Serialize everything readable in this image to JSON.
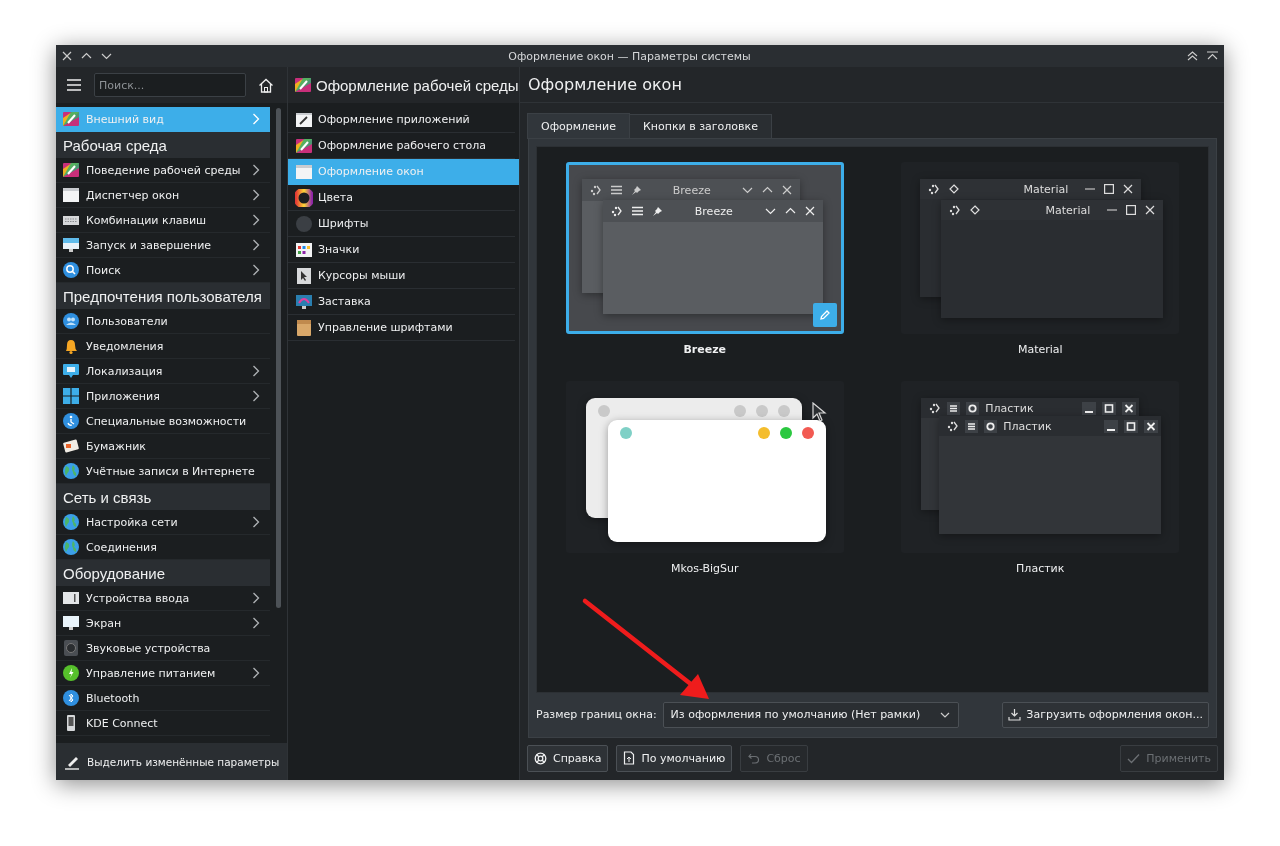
{
  "window": {
    "title": "Оформление окон — Параметры системы"
  },
  "sidebar": {
    "search": {
      "placeholder": "Поиск..."
    },
    "items": [
      {
        "kind": "item",
        "label": "Внешний вид",
        "selected": true,
        "expandable": true
      },
      {
        "kind": "header",
        "label": "Рабочая среда"
      },
      {
        "kind": "item",
        "label": "Поведение рабочей среды",
        "selected": false,
        "expandable": true
      },
      {
        "kind": "item",
        "label": "Диспетчер окон",
        "selected": false,
        "expandable": true
      },
      {
        "kind": "item",
        "label": "Комбинации клавиш",
        "selected": false,
        "expandable": true
      },
      {
        "kind": "item",
        "label": "Запуск и завершение",
        "selected": false,
        "expandable": true
      },
      {
        "kind": "item",
        "label": "Поиск",
        "selected": false,
        "expandable": true
      },
      {
        "kind": "header",
        "label": "Предпочтения пользователя"
      },
      {
        "kind": "item",
        "label": "Пользователи",
        "selected": false,
        "expandable": false
      },
      {
        "kind": "item",
        "label": "Уведомления",
        "selected": false,
        "expandable": false
      },
      {
        "kind": "item",
        "label": "Локализация",
        "selected": false,
        "expandable": true
      },
      {
        "kind": "item",
        "label": "Приложения",
        "selected": false,
        "expandable": true
      },
      {
        "kind": "item",
        "label": "Специальные возможности",
        "selected": false,
        "expandable": false
      },
      {
        "kind": "item",
        "label": "Бумажник",
        "selected": false,
        "expandable": false
      },
      {
        "kind": "item",
        "label": "Учётные записи в Интернете",
        "selected": false,
        "expandable": false
      },
      {
        "kind": "header",
        "label": "Сеть и связь"
      },
      {
        "kind": "item",
        "label": "Настройка сети",
        "selected": false,
        "expandable": true
      },
      {
        "kind": "item",
        "label": "Соединения",
        "selected": false,
        "expandable": false
      },
      {
        "kind": "header",
        "label": "Оборудование"
      },
      {
        "kind": "item",
        "label": "Устройства ввода",
        "selected": false,
        "expandable": true
      },
      {
        "kind": "item",
        "label": "Экран",
        "selected": false,
        "expandable": true
      },
      {
        "kind": "item",
        "label": "Звуковые устройства",
        "selected": false,
        "expandable": false
      },
      {
        "kind": "item",
        "label": "Управление питанием",
        "selected": false,
        "expandable": true
      },
      {
        "kind": "item",
        "label": "Bluetooth",
        "selected": false,
        "expandable": false
      },
      {
        "kind": "item",
        "label": "KDE Connect",
        "selected": false,
        "expandable": false
      }
    ],
    "highlight_button": "Выделить изменённые параметры"
  },
  "subpanel": {
    "title": "Оформление рабочей среды",
    "items": [
      {
        "label": "Оформление приложений",
        "selected": false
      },
      {
        "label": "Оформление рабочего стола",
        "selected": false
      },
      {
        "label": "Оформление окон",
        "selected": true
      },
      {
        "label": "Цвета",
        "selected": false
      },
      {
        "label": "Шрифты",
        "selected": false
      },
      {
        "label": "Значки",
        "selected": false
      },
      {
        "label": "Курсоры мыши",
        "selected": false
      },
      {
        "label": "Заставка",
        "selected": false
      },
      {
        "label": "Управление шрифтами",
        "selected": false
      }
    ]
  },
  "main": {
    "title": "Оформление окон",
    "tabs": [
      {
        "label": "Оформление",
        "selected": true
      },
      {
        "label": "Кнопки в заголовке",
        "selected": false
      }
    ],
    "themes": [
      {
        "name": "Breeze",
        "kind": "breeze",
        "selected": true,
        "preview_titles": [
          "Breeze",
          "Breeze"
        ]
      },
      {
        "name": "Material",
        "kind": "material",
        "selected": false,
        "preview_titles": [
          "Material",
          "Material"
        ]
      },
      {
        "name": "Mkos-BigSur",
        "kind": "bigsur",
        "selected": false
      },
      {
        "name": "Пластик",
        "kind": "plastik",
        "selected": false,
        "preview_titles": [
          "Пластик",
          "Пластик"
        ]
      }
    ],
    "border_size": {
      "label": "Размер границ окна:",
      "value": "Из оформления по умолчанию (Нет рамки)"
    },
    "get_new_button": "Загрузить оформления окон..."
  },
  "footer": {
    "buttons": [
      {
        "kind": "help",
        "label": "Справка",
        "disabled": false
      },
      {
        "kind": "defaults",
        "label": "По умолчанию",
        "disabled": false
      },
      {
        "kind": "reset",
        "label": "Сброс",
        "disabled": true
      },
      {
        "kind": "apply",
        "label": "Применить",
        "disabled": true
      }
    ]
  }
}
